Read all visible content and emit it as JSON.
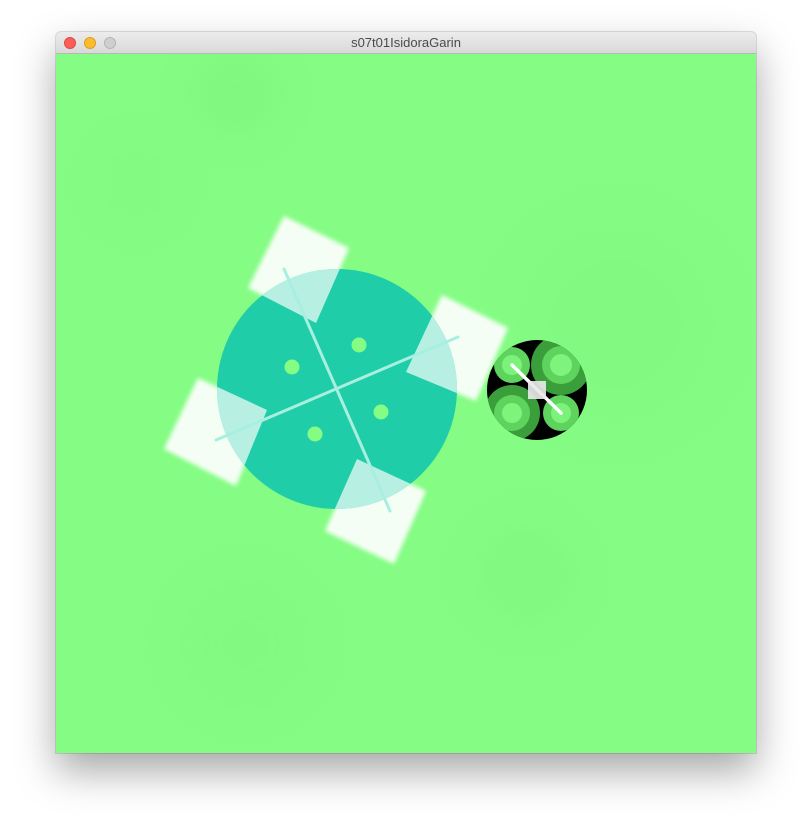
{
  "window": {
    "title": "s07t01IsidoraGarin"
  },
  "sketch": {
    "background_color": "#85fc84",
    "main_disc_color": "#1fcea8",
    "accent_dot_color": "#85fc84",
    "panel_color": "#ffffff",
    "small_disc_color": "#000000",
    "small_disc_ring_color": "#5ed35d",
    "small_disc_inner_color": "#86fc84"
  }
}
